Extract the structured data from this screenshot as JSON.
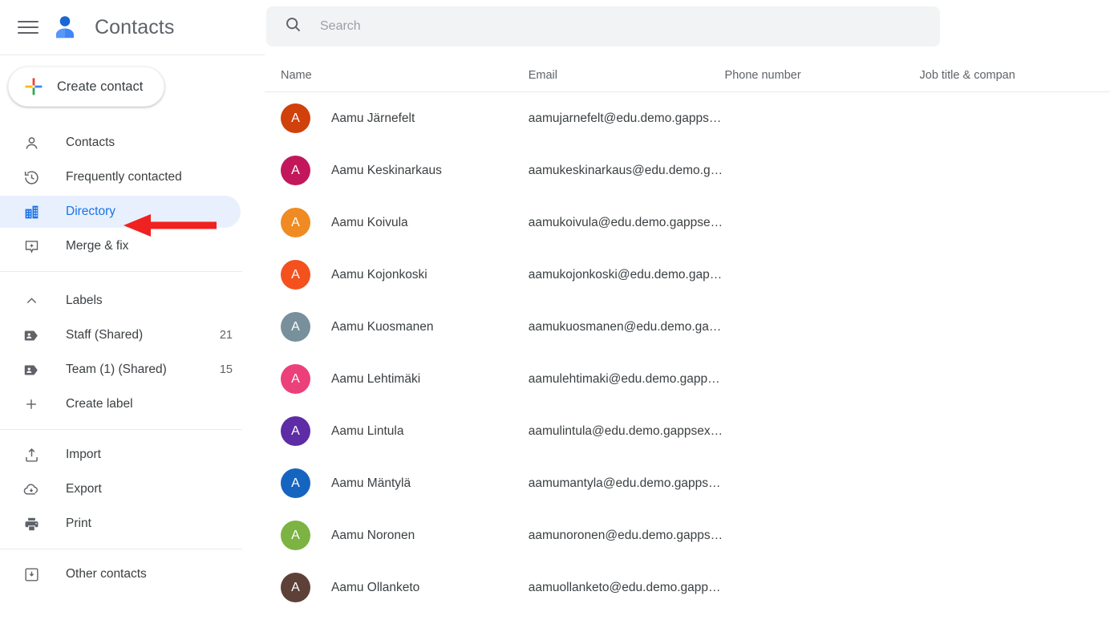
{
  "app": {
    "title": "Contacts",
    "menu_icon": "hamburger-menu-icon",
    "logo_icon": "contacts-person-logo-icon"
  },
  "sidebar": {
    "create_button": {
      "label": "Create contact",
      "icon": "google-plus-icon"
    },
    "nav": [
      {
        "label": "Contacts",
        "icon": "person-outline-icon",
        "active": false
      },
      {
        "label": "Frequently contacted",
        "icon": "history-clock-icon",
        "active": false
      },
      {
        "label": "Directory",
        "icon": "building-directory-icon",
        "active": true
      },
      {
        "label": "Merge & fix",
        "icon": "merge-sparkle-icon",
        "active": false
      }
    ],
    "labels_section": {
      "header": {
        "label": "Labels",
        "icon": "chevron-up-icon"
      },
      "items": [
        {
          "label": "Staff (Shared)",
          "count": "21",
          "icon": "label-tag-icon"
        },
        {
          "label": "Team (1) (Shared)",
          "count": "15",
          "icon": "label-tag-icon"
        }
      ],
      "create_label": {
        "label": "Create label",
        "icon": "plus-icon"
      }
    },
    "tools": [
      {
        "label": "Import",
        "icon": "import-upload-icon"
      },
      {
        "label": "Export",
        "icon": "export-cloud-download-icon"
      },
      {
        "label": "Print",
        "icon": "printer-icon"
      }
    ],
    "other": [
      {
        "label": "Other contacts",
        "icon": "other-contacts-box-icon"
      }
    ]
  },
  "search": {
    "placeholder": "Search",
    "value": "",
    "icon": "search-magnifier-icon"
  },
  "table": {
    "columns": [
      "Name",
      "Email",
      "Phone number",
      "Job title & compan"
    ],
    "rows": [
      {
        "initial": "A",
        "color": "#d1410c",
        "name": "Aamu Järnefelt",
        "email": "aamujarnefelt@edu.demo.gapps…",
        "phone": "",
        "job": ""
      },
      {
        "initial": "A",
        "color": "#c2185b",
        "name": "Aamu Keskinarkaus",
        "email": "aamukeskinarkaus@edu.demo.g…",
        "phone": "",
        "job": ""
      },
      {
        "initial": "A",
        "color": "#ef8b22",
        "name": "Aamu Koivula",
        "email": "aamukoivula@edu.demo.gappse…",
        "phone": "",
        "job": ""
      },
      {
        "initial": "A",
        "color": "#f4511e",
        "name": "Aamu Kojonkoski",
        "email": "aamukojonkoski@edu.demo.gap…",
        "phone": "",
        "job": ""
      },
      {
        "initial": "A",
        "color": "#78909c",
        "name": "Aamu Kuosmanen",
        "email": "aamukuosmanen@edu.demo.ga…",
        "phone": "",
        "job": ""
      },
      {
        "initial": "A",
        "color": "#ec407a",
        "name": "Aamu Lehtimäki",
        "email": "aamulehtimaki@edu.demo.gapp…",
        "phone": "",
        "job": ""
      },
      {
        "initial": "A",
        "color": "#5e2ca5",
        "name": "Aamu Lintula",
        "email": "aamulintula@edu.demo.gappsex…",
        "phone": "",
        "job": ""
      },
      {
        "initial": "A",
        "color": "#1565c0",
        "name": "Aamu Mäntylä",
        "email": "aamumantyla@edu.demo.gapps…",
        "phone": "",
        "job": ""
      },
      {
        "initial": "A",
        "color": "#7cb342",
        "name": "Aamu Noronen",
        "email": "aamunoronen@edu.demo.gapps…",
        "phone": "",
        "job": ""
      },
      {
        "initial": "A",
        "color": "#5d4037",
        "name": "Aamu Ollanketo",
        "email": "aamuollanketo@edu.demo.gapp…",
        "phone": "",
        "job": ""
      }
    ]
  },
  "annotation": {
    "arrow": {
      "color": "#f02121",
      "points_to": "Directory",
      "direction": "left"
    }
  },
  "colors": {
    "accent_blue": "#1a73e8",
    "active_pill_bg": "#e8f0fe",
    "search_bg": "#f1f3f4",
    "text_primary": "#3c4043",
    "text_secondary": "#5f6368",
    "divider": "#e8eaed",
    "annotation_red": "#f02121"
  }
}
